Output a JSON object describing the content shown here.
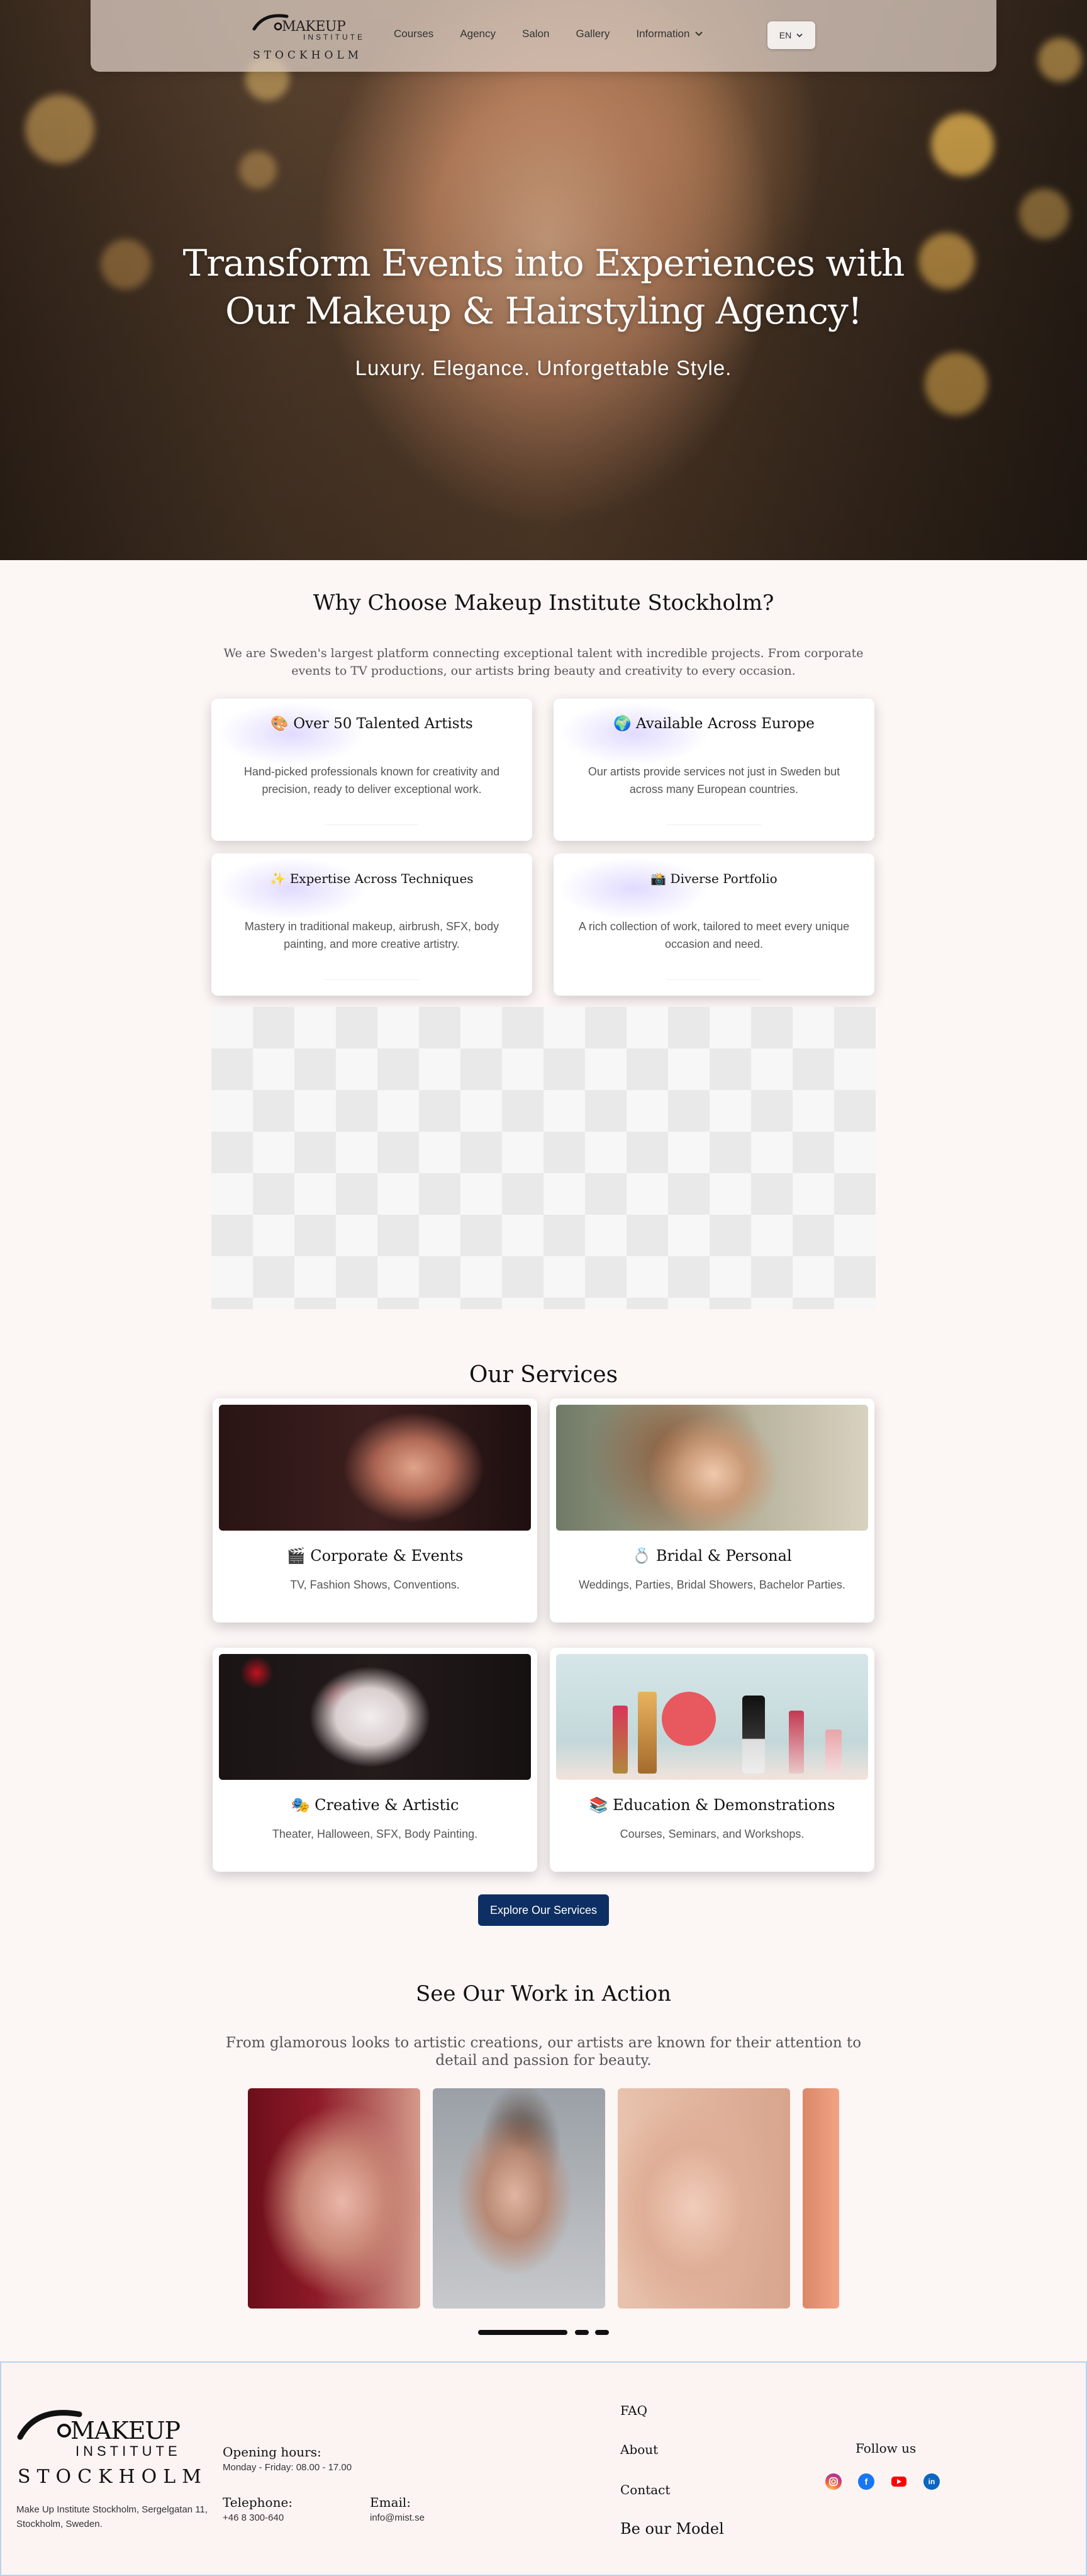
{
  "nav": {
    "logo": {
      "line1": "MAKEUP",
      "line2": "INSTITUTE",
      "line3": "STOCKHOLM"
    },
    "links": [
      "Courses",
      "Agency",
      "Salon",
      "Gallery"
    ],
    "info_label": "Information",
    "lang": "EN"
  },
  "hero": {
    "title_line1": "Transform Events into Experiences with",
    "title_line2": "Our Makeup & Hairstyling Agency!",
    "subtitle": "Luxury. Elegance. Unforgettable Style."
  },
  "why": {
    "title": "Why Choose Makeup Institute Stockholm?",
    "intro": "We are Sweden's largest platform connecting exceptional talent with incredible projects. From corporate events to TV productions, our artists bring beauty and creativity to every occasion.",
    "cards": [
      {
        "icon": "🎨",
        "title": "Over 50 Talented Artists",
        "desc": "Hand-picked professionals known for creativity and precision, ready to deliver exceptional work."
      },
      {
        "icon": "🌍",
        "title": "Available Across Europe",
        "desc": "Our artists provide services not just in Sweden but across many European countries."
      },
      {
        "icon": "✨",
        "title": "Expertise Across Techniques",
        "desc": "Mastery in traditional makeup, airbrush, SFX, body painting, and more creative artistry."
      },
      {
        "icon": "📸",
        "title": "Diverse Portfolio",
        "desc": "A rich collection of work, tailored to meet every unique occasion and need."
      }
    ]
  },
  "services": {
    "title": "Our Services",
    "cards": [
      {
        "icon": "🎬",
        "title": "Corporate & Events",
        "desc": "TV, Fashion Shows, Conventions."
      },
      {
        "icon": "💍",
        "title": "Bridal & Personal",
        "desc": "Weddings, Parties, Bridal Showers, Bachelor Parties."
      },
      {
        "icon": "🎭",
        "title": "Creative & Artistic",
        "desc": "Theater, Halloween, SFX, Body Painting."
      },
      {
        "icon": "📚",
        "title": "Education & Demonstrations",
        "desc": "Courses, Seminars, and Workshops."
      }
    ],
    "button": "Explore Our Services"
  },
  "work": {
    "title": "See Our Work in Action",
    "intro": "From glamorous looks to artistic creations, our artists are known for their attention to detail and passion for beauty."
  },
  "footer": {
    "logo": {
      "line1": "MAKEUP",
      "line2": "INSTITUTE",
      "line3": "STOCKHOLM"
    },
    "address": "Make Up Institute Stockholm, Sergelgatan 11, Stockholm, Sweden.",
    "hours_label": "Opening hours:",
    "hours": "Monday - Friday: 08.00  - 17.00",
    "phone_label": "Telephone:",
    "phone": "+46 8 300-640",
    "email_label": "Email:",
    "email": "info@mist.se",
    "links": [
      "FAQ",
      "About",
      "Contact",
      "Be our Model"
    ],
    "follow": "Follow us",
    "social": [
      "instagram-icon",
      "facebook-icon",
      "youtube-icon",
      "linkedin-icon"
    ]
  },
  "colors": {
    "accent": "#0e2f63",
    "background": "#fcf6f5"
  }
}
